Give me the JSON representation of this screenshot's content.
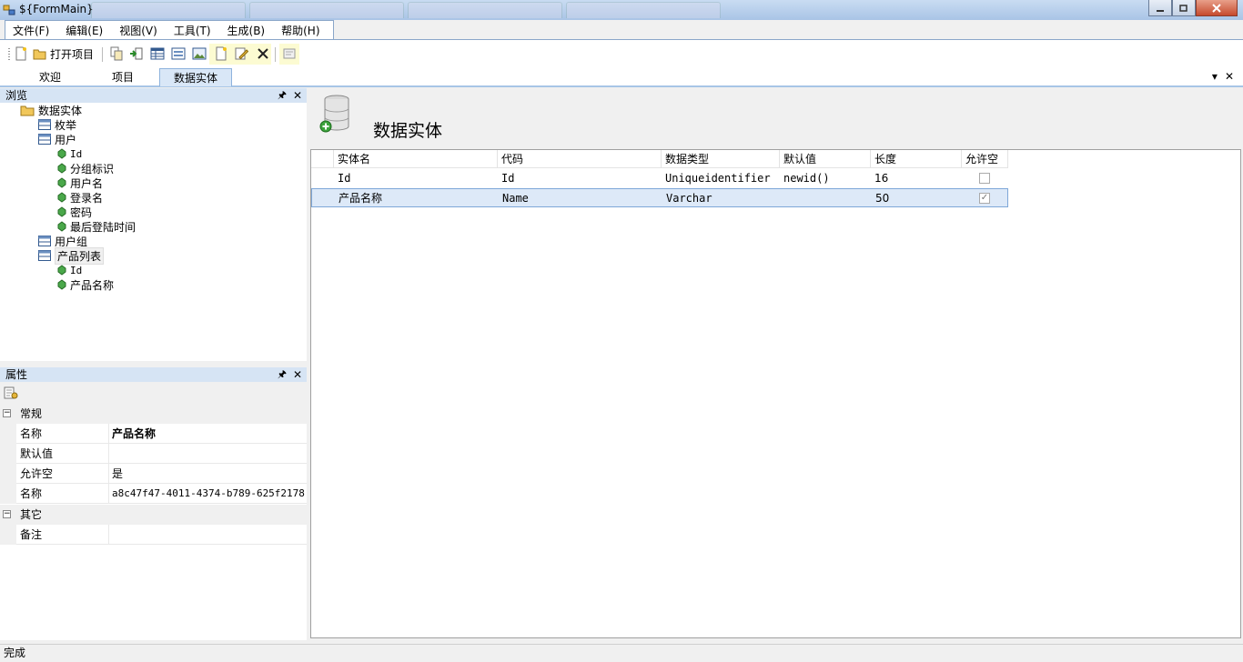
{
  "window": {
    "title": "${FormMain}"
  },
  "menu": {
    "items": [
      "文件(F)",
      "编辑(E)",
      "视图(V)",
      "工具(T)",
      "生成(B)",
      "帮助(H)"
    ]
  },
  "toolbar": {
    "open_project_label": "打开项目"
  },
  "doc_tabs": {
    "tabs": [
      "欢迎",
      "项目",
      "数据实体"
    ],
    "active": "数据实体"
  },
  "browse_panel": {
    "title": "浏览",
    "tree": {
      "root": "数据实体",
      "enum": "枚举",
      "user": "用户",
      "user_fields": [
        "Id",
        "分组标识",
        "用户名",
        "登录名",
        "密码",
        "最后登陆时间"
      ],
      "user_group": "用户组",
      "product_list": "产品列表",
      "product_fields": [
        "Id",
        "产品名称"
      ]
    }
  },
  "props_panel": {
    "title": "属性",
    "category_general": "常规",
    "category_other": "其它",
    "rows": [
      {
        "name": "名称",
        "value": "产品名称"
      },
      {
        "name": "默认值",
        "value": ""
      },
      {
        "name": "允许空",
        "value": "是"
      },
      {
        "name": "名称",
        "value": "a8c47f47-4011-4374-b789-625f2178..."
      }
    ],
    "other_rows": [
      {
        "name": "备注",
        "value": ""
      }
    ]
  },
  "main": {
    "title": "数据实体",
    "columns": [
      "实体名",
      "代码",
      "数据类型",
      "默认值",
      "长度",
      "允许空"
    ],
    "rows": [
      {
        "name": "Id",
        "code": "Id",
        "type": "Uniqueidentifier",
        "default": "newid()",
        "length": "16",
        "nullable": false
      },
      {
        "name": "产品名称",
        "code": "Name",
        "type": "Varchar",
        "default": "",
        "length": "50",
        "nullable": true
      }
    ]
  },
  "status": {
    "text": "完成"
  },
  "colors": {
    "accent": "#a7c5e6",
    "selection": "#dde9f8",
    "panel_header": "#d6e4f4"
  }
}
